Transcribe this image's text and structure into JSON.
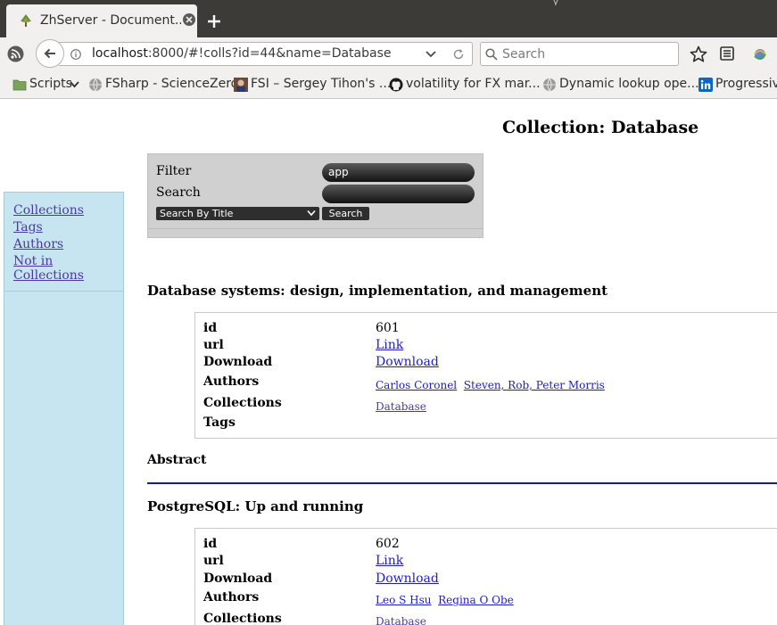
{
  "browser": {
    "tab_title": "ZhServer - Document...",
    "url_host": "localhost",
    "url_rest": ":8000/#!colls?id=44&name=Database",
    "search_placeholder": "Search",
    "top_fade_text": "y"
  },
  "bookmarks": [
    {
      "label": "Scripts",
      "icon": "folder-icon"
    },
    {
      "label": "FSharp - ScienceZero",
      "icon": "globe-icon"
    },
    {
      "label": "FSI – Sergey Tihon's ...",
      "icon": "avatar-icon"
    },
    {
      "label": "volatility for FX mar...",
      "icon": "github-icon"
    },
    {
      "label": "Dynamic lookup ope...",
      "icon": "globe-icon"
    },
    {
      "label": "Progressiv",
      "icon": "linkedin-icon"
    }
  ],
  "page": {
    "title": "Collection: Database",
    "sidebar": [
      "Collections",
      "Tags",
      "Authors",
      "Not in",
      "Collections"
    ],
    "filter": {
      "filter_label": "Filter",
      "filter_value": "app",
      "search_label": "Search",
      "search_value": "",
      "mode": "Search By Title",
      "button": "Search"
    },
    "documents": [
      {
        "title": "Database systems: design, implementation, and management",
        "fields": {
          "id_label": "id",
          "id": "601",
          "url_label": "url",
          "url": "Link",
          "download_label": "Download",
          "download": "Download",
          "authors_label": "Authors",
          "authors": [
            "Carlos Coronel",
            "Steven, Rob, Peter Morris"
          ],
          "collections_label": "Collections",
          "collections": [
            "Database"
          ],
          "tags_label": "Tags"
        },
        "abstract_label": "Abstract"
      },
      {
        "title": "PostgreSQL: Up and running",
        "fields": {
          "id_label": "id",
          "id": "602",
          "url_label": "url",
          "url": "Link",
          "download_label": "Download",
          "download": "Download",
          "authors_label": "Authors",
          "authors": [
            "Leo S Hsu",
            "Regina O Obe"
          ],
          "collections_label": "Collections",
          "collections": [
            "Database"
          ]
        }
      }
    ]
  },
  "colors": {
    "sidebar_bg": "#c7e5f0",
    "link": "#1c1ccc",
    "visited_link": "#4a3aa0",
    "divider": "#1515c0"
  }
}
